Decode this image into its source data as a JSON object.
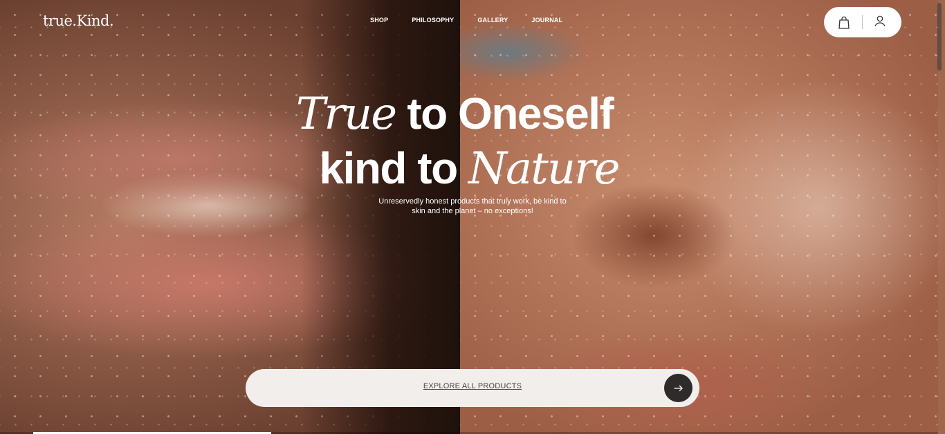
{
  "brand": {
    "logo_text": "true.Kind."
  },
  "nav": {
    "items": [
      {
        "label": "SHOP"
      },
      {
        "label": "PHILOSOPHY"
      },
      {
        "label": "GALLERY"
      },
      {
        "label": "JOURNAL"
      }
    ]
  },
  "utility": {
    "icons": [
      "shopping-bag-icon",
      "user-icon"
    ]
  },
  "hero": {
    "line1_serif": "True",
    "line1_sans": " to Oneself",
    "line2_sans": "kind to ",
    "line2_serif": "Nature",
    "subtext": "Unreservedly honest products that truly work, be kind to skin and the planet – no exceptions!"
  },
  "cta": {
    "label": "EXPLORE ALL PRODUCTS",
    "arrow_icon": "arrow-right-icon"
  },
  "colors": {
    "text_on_hero": "#ffffff",
    "cta_background": "#f2eeeb",
    "cta_button": "#2f2b2a"
  }
}
